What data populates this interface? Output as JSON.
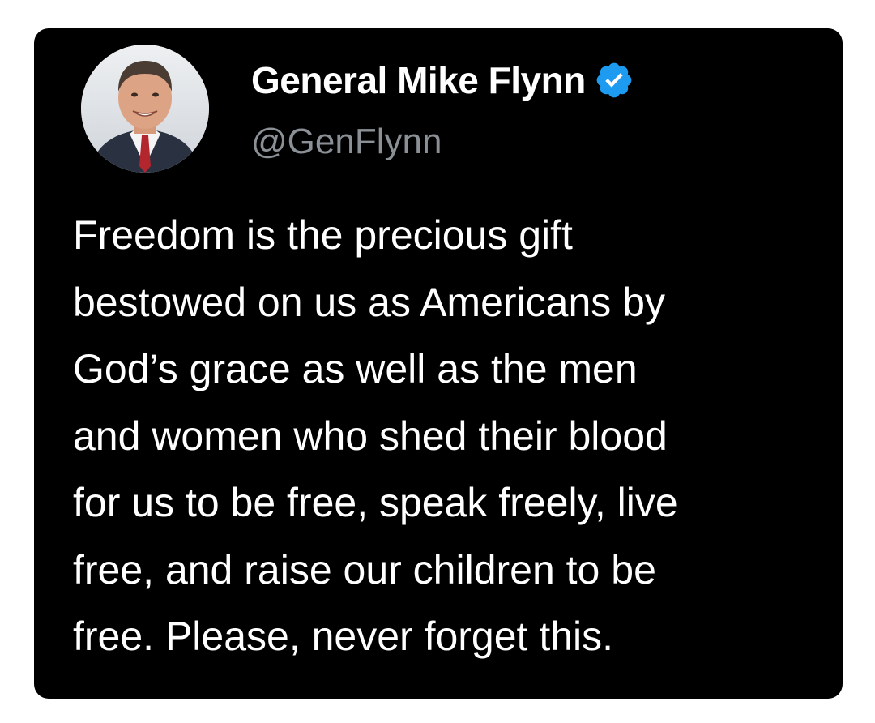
{
  "tweet": {
    "author": {
      "display_name": "General Mike Flynn",
      "handle": "@GenFlynn",
      "verified": true,
      "verified_icon": "verified-badge-icon"
    },
    "text_lines": [
      "Freedom is the precious gift",
      "bestowed on us as Americans by",
      "God’s grace as well as the men",
      "and women who shed their blood",
      "for us to be free, speak freely, live",
      "free, and raise our children to be",
      "free. Please, never forget this."
    ]
  },
  "colors": {
    "card_background": "#000000",
    "page_background": "#ffffff",
    "text_primary": "#ffffff",
    "text_secondary": "#8b9096",
    "verified_blue": "#1d9bf0"
  }
}
